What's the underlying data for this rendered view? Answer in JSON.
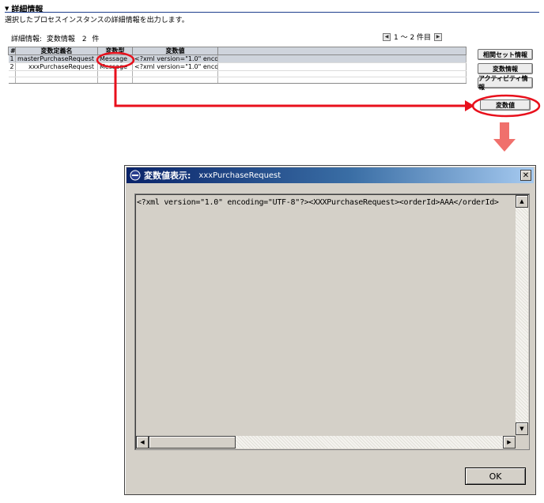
{
  "section": {
    "title": "詳細情報",
    "description": "選択したプロセスインスタンスの詳細情報を出力します。"
  },
  "info": {
    "label": "詳細情報:",
    "category": "変数情報",
    "count": "2",
    "unit": "件"
  },
  "pager": {
    "text": "1 ～ 2 件目"
  },
  "table": {
    "headers": [
      "#",
      "変数定義名",
      "変数型",
      "変数値"
    ],
    "rows": [
      [
        "1",
        "masterPurchaseRequest",
        "Message",
        "<?xml version=\"1.0\" enco..."
      ],
      [
        "2",
        "xxxPurchaseRequest",
        "Message",
        "<?xml version=\"1.0\" enco..."
      ]
    ]
  },
  "buttons": {
    "related_set": "相関セット情報",
    "var_info": "変数情報",
    "activity_info": "アクティビティ情報",
    "var_value": "変数値"
  },
  "dialog": {
    "title": "変数値表示:",
    "subtitle": "xxxPurchaseRequest",
    "content": "<?xml version=\"1.0\" encoding=\"UTF-8\"?><XXXPurchaseRequest><orderId>AAA</orderId>",
    "ok_label": "OK",
    "close_glyph": "✕"
  },
  "colors": {
    "annotation": "#e8101c",
    "arrow_down": "#f0706c",
    "title_start": "#0a246a"
  }
}
